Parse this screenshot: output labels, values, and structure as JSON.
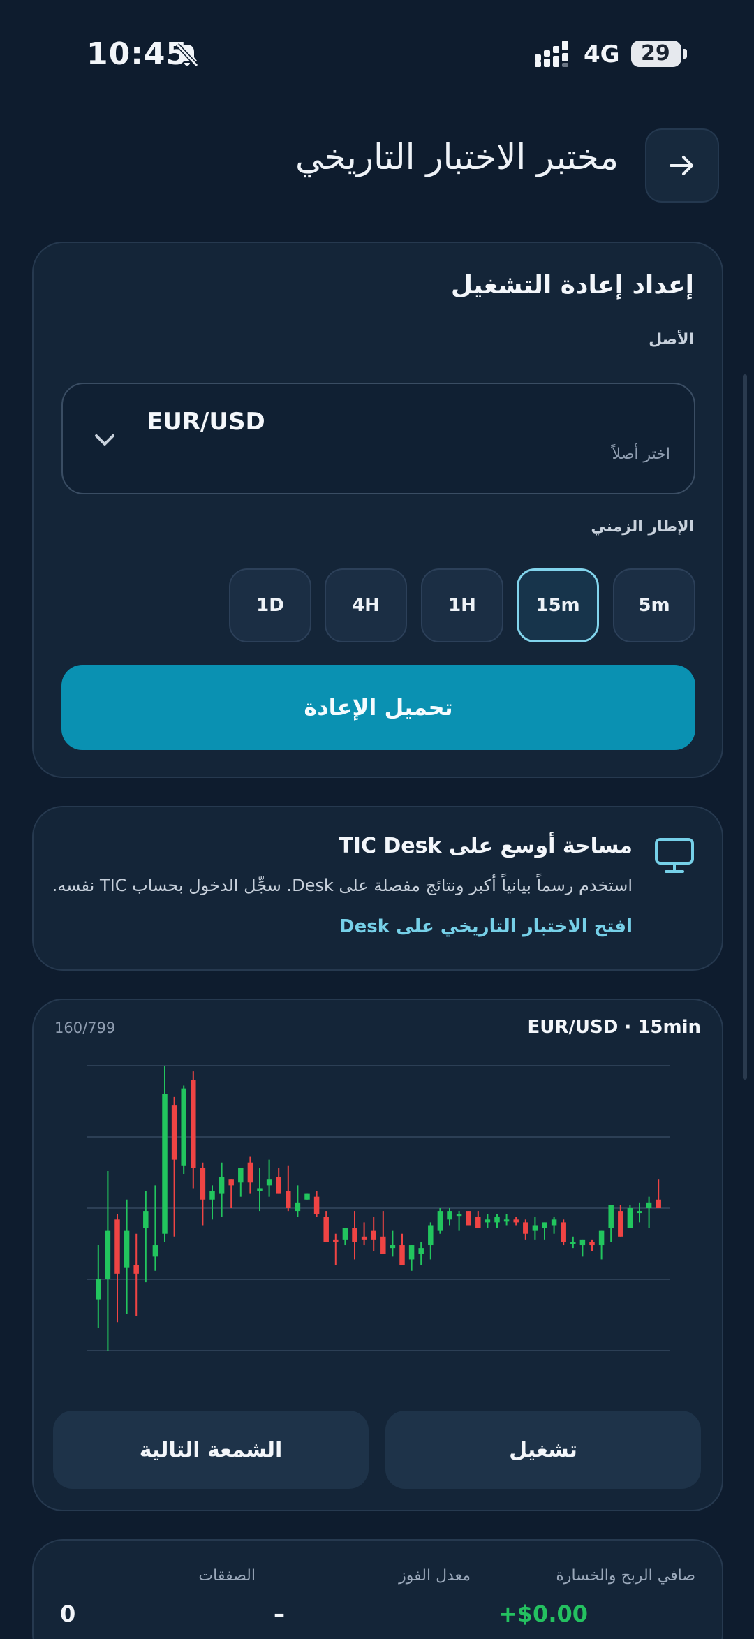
{
  "status_bar": {
    "time": "10:45",
    "network": "4G",
    "battery": "29"
  },
  "header": {
    "title": "مختبر الاختبار التاريخي"
  },
  "setup": {
    "title": "إعداد إعادة التشغيل",
    "asset_label": "الأصل",
    "asset_value": "EUR/USD",
    "asset_hint": "اختر أصلاً",
    "timeframe_label": "الإطار الزمني",
    "timeframes": [
      "5m",
      "15m",
      "1H",
      "4H",
      "1D"
    ],
    "selected_timeframe": "15m",
    "load_button": "تحميل الإعادة"
  },
  "desk": {
    "title": "مساحة أوسع على TIC Desk",
    "description": "استخدم رسماً بيانياً أكبر ونتائج مفصلة على Desk. سجِّل الدخول بحساب TIC نفسه.",
    "link": "افتح الاختبار التاريخي على Desk"
  },
  "chart_panel": {
    "title": "EUR/USD · 15min",
    "counter": "160/799",
    "next_candle_button": "الشمعة التالية",
    "play_button": "تشغيل"
  },
  "stats": {
    "pnl_label": "صافي الربح والخسارة",
    "pnl_value": "+$0.00",
    "win_rate_label": "معدل الفوز",
    "win_rate_value": "–",
    "trades_label": "الصفقات",
    "trades_value": "0"
  },
  "colors": {
    "up": "#22c55e",
    "down": "#ef4444",
    "accent": "#0a91b2",
    "background": "#0e1c2e"
  },
  "chart_data": {
    "type": "candlestick",
    "ylim": [
      0,
      100
    ],
    "candles": [
      {
        "o": 18,
        "h": 37,
        "l": 8,
        "c": 25
      },
      {
        "o": 25,
        "h": 63,
        "l": 0,
        "c": 42
      },
      {
        "o": 46,
        "h": 48,
        "l": 10,
        "c": 27
      },
      {
        "o": 29,
        "h": 53,
        "l": 13,
        "c": 42
      },
      {
        "o": 30,
        "h": 41,
        "l": 12,
        "c": 27
      },
      {
        "o": 43,
        "h": 56,
        "l": 24,
        "c": 49
      },
      {
        "o": 33,
        "h": 58,
        "l": 28,
        "c": 37
      },
      {
        "o": 41,
        "h": 100,
        "l": 38,
        "c": 90
      },
      {
        "o": 86,
        "h": 89,
        "l": 40,
        "c": 67
      },
      {
        "o": 65,
        "h": 93,
        "l": 62,
        "c": 92
      },
      {
        "o": 95,
        "h": 98,
        "l": 57,
        "c": 64
      },
      {
        "o": 64,
        "h": 66,
        "l": 44,
        "c": 53
      },
      {
        "o": 53,
        "h": 58,
        "l": 46,
        "c": 56
      },
      {
        "o": 55,
        "h": 66,
        "l": 47,
        "c": 61
      },
      {
        "o": 60,
        "h": 60,
        "l": 50,
        "c": 58
      },
      {
        "o": 59,
        "h": 64,
        "l": 54,
        "c": 64
      },
      {
        "o": 66,
        "h": 68,
        "l": 55,
        "c": 59
      },
      {
        "o": 56,
        "h": 64,
        "l": 49,
        "c": 57
      },
      {
        "o": 58,
        "h": 67,
        "l": 54,
        "c": 60
      },
      {
        "o": 61,
        "h": 64,
        "l": 57,
        "c": 55
      },
      {
        "o": 56,
        "h": 65,
        "l": 49,
        "c": 50
      },
      {
        "o": 49,
        "h": 58,
        "l": 47,
        "c": 52
      },
      {
        "o": 53,
        "h": 52,
        "l": 53,
        "c": 55
      },
      {
        "o": 54,
        "h": 56,
        "l": 47,
        "c": 48
      },
      {
        "o": 47,
        "h": 49,
        "l": 38,
        "c": 38
      },
      {
        "o": 39,
        "h": 41,
        "l": 30,
        "c": 38
      },
      {
        "o": 39,
        "h": 43,
        "l": 37,
        "c": 43
      },
      {
        "o": 43,
        "h": 49,
        "l": 32,
        "c": 38
      },
      {
        "o": 40,
        "h": 45,
        "l": 37,
        "c": 39
      },
      {
        "o": 42,
        "h": 47,
        "l": 35,
        "c": 39
      },
      {
        "o": 40,
        "h": 49,
        "l": 35,
        "c": 34
      },
      {
        "o": 36,
        "h": 42,
        "l": 33,
        "c": 37
      },
      {
        "o": 37,
        "h": 41,
        "l": 30,
        "c": 30
      },
      {
        "o": 32,
        "h": 37,
        "l": 28,
        "c": 37
      },
      {
        "o": 34,
        "h": 38,
        "l": 30,
        "c": 36
      },
      {
        "o": 37,
        "h": 45,
        "l": 32,
        "c": 44
      },
      {
        "o": 42,
        "h": 50,
        "l": 41,
        "c": 49
      },
      {
        "o": 46,
        "h": 50,
        "l": 44,
        "c": 49
      },
      {
        "o": 48,
        "h": 49,
        "l": 42,
        "c": 48
      },
      {
        "o": 49,
        "h": 49,
        "l": 44,
        "c": 44
      },
      {
        "o": 47,
        "h": 49,
        "l": 43,
        "c": 43
      },
      {
        "o": 45,
        "h": 48,
        "l": 43,
        "c": 46
      },
      {
        "o": 45,
        "h": 48,
        "l": 43,
        "c": 47
      },
      {
        "o": 46,
        "h": 48,
        "l": 44,
        "c": 46
      },
      {
        "o": 46,
        "h": 47,
        "l": 44,
        "c": 45
      },
      {
        "o": 45,
        "h": 46,
        "l": 39,
        "c": 41
      },
      {
        "o": 42,
        "h": 47,
        "l": 39,
        "c": 44
      },
      {
        "o": 43,
        "h": 45,
        "l": 39,
        "c": 45
      },
      {
        "o": 44,
        "h": 47,
        "l": 41,
        "c": 46
      },
      {
        "o": 45,
        "h": 46,
        "l": 37,
        "c": 38
      },
      {
        "o": 38,
        "h": 40,
        "l": 36,
        "c": 38
      },
      {
        "o": 37,
        "h": 39,
        "l": 33,
        "c": 39
      },
      {
        "o": 38,
        "h": 39,
        "l": 35,
        "c": 37
      },
      {
        "o": 37,
        "h": 40,
        "l": 32,
        "c": 42
      },
      {
        "o": 43,
        "h": 51,
        "l": 38,
        "c": 51
      },
      {
        "o": 49,
        "h": 51,
        "l": 40,
        "c": 40
      },
      {
        "o": 43,
        "h": 51,
        "l": 43,
        "c": 50
      },
      {
        "o": 49,
        "h": 52,
        "l": 45,
        "c": 49
      },
      {
        "o": 50,
        "h": 54,
        "l": 43,
        "c": 52
      },
      {
        "o": 53,
        "h": 60,
        "l": 50,
        "c": 50
      }
    ]
  }
}
